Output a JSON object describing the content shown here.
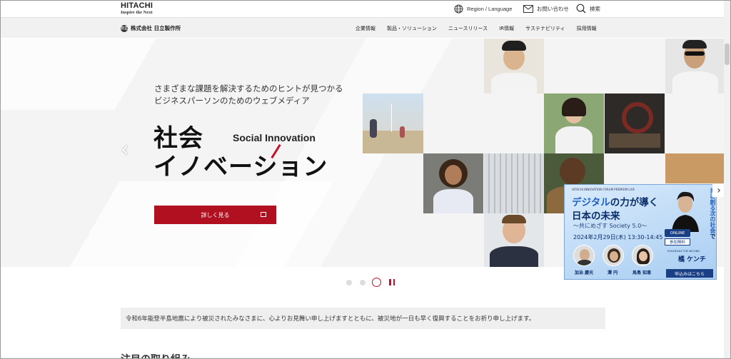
{
  "header": {
    "logo_line1": "HITACHI",
    "logo_line2": "Inspire the Next",
    "region_label": "Region / Language",
    "contact_label": "お問い合わせ",
    "search_label": "検索"
  },
  "nav": {
    "company_name": "株式会社 日立製作所",
    "company_mark": "日立",
    "items": [
      "企業情報",
      "製品・ソリューション",
      "ニュースリリース",
      "IR情報",
      "サステナビリティ",
      "採用情報"
    ]
  },
  "hero": {
    "tagline_line1": "さまざまな課題を解決するためのヒントが見つかる",
    "tagline_line2": "ビジネスパーソンのためのウェブメディア",
    "title_line1": "社会",
    "title_line2": "イノベーション",
    "title_en": "Social Innovation",
    "more_button": "詳しく見る",
    "prev_arrow": "‹",
    "next_arrow": "›"
  },
  "banner": {
    "small_text": "HITACHI INNOVATION FORUM PREMIUM LIVE",
    "line1_a": "デジタル",
    "line1_b": "の力が導く",
    "line2": "日本の未来",
    "subtitle": "〜共にめざす Society 5.0〜",
    "date": "2024年2月29日(木) 13:30-14:45",
    "online": "ONLINE",
    "free": "参加無料",
    "vertical_a": "共に創る次の社会",
    "vertical_b": "で",
    "speakers": [
      "加治 慶光",
      "澤 円",
      "馬島 知恵"
    ],
    "guest_tag": "EXILE/EXILE THE SECOND",
    "guest": "橘 ケンチ",
    "cta": "申込みはこちら",
    "arrow": "›"
  },
  "notice": {
    "text": "令和6年能登半島地震により被災されたみなさまに、心よりお見舞い申し上げますとともに、被災地が一日も早く復興することをお祈り申し上げます。"
  },
  "bottom": {
    "heading": "注目の取り組み"
  },
  "colors": {
    "brand_red": "#b0101f",
    "banner_navy": "#1b3f84",
    "nav_bg": "#f1f1f1"
  }
}
